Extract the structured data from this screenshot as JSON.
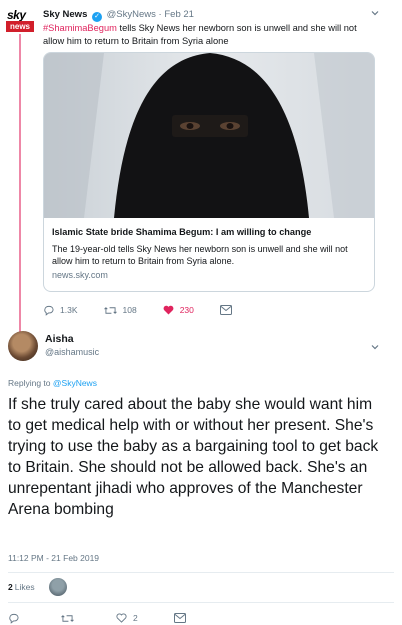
{
  "parent_tweet": {
    "logo_text_top": "sky",
    "logo_text_bottom": "news",
    "name": "Sky News",
    "handle": "@SkyNews",
    "separator": "·",
    "date": "Feb 21",
    "hashtag": "#ShamimaBegum",
    "text": " tells Sky News her newborn son is unwell and she will not allow him to return to Britain from Syria alone",
    "card": {
      "title": "Islamic State bride Shamima Begum: I am willing to change",
      "description": "The 19-year-old tells Sky News her newborn son is unwell and she will not allow him to return to Britain from Syria alone.",
      "domain": "news.sky.com"
    },
    "actions": {
      "replies": "1.3K",
      "retweets": "108",
      "likes": "230"
    }
  },
  "reply_tweet": {
    "name": "Aisha",
    "handle": "@aishamusic",
    "replying_prefix": "Replying to ",
    "replying_to": "@SkyNews",
    "text": "If she truly cared about the baby she would want him to get medical help with or without her present. She's trying to use the baby as a bargaining tool to get back to Britain. She should not be allowed back. She's an unrepentant jihadi who approves of the Manchester Arena bombing",
    "timestamp": "11:12 PM - 21 Feb 2019",
    "likes_count": "2",
    "likes_label": "Likes",
    "actions": {
      "likes": "2"
    }
  },
  "colors": {
    "accent": "#1da1f2",
    "like": "#e0245e",
    "muted": "#657786"
  }
}
